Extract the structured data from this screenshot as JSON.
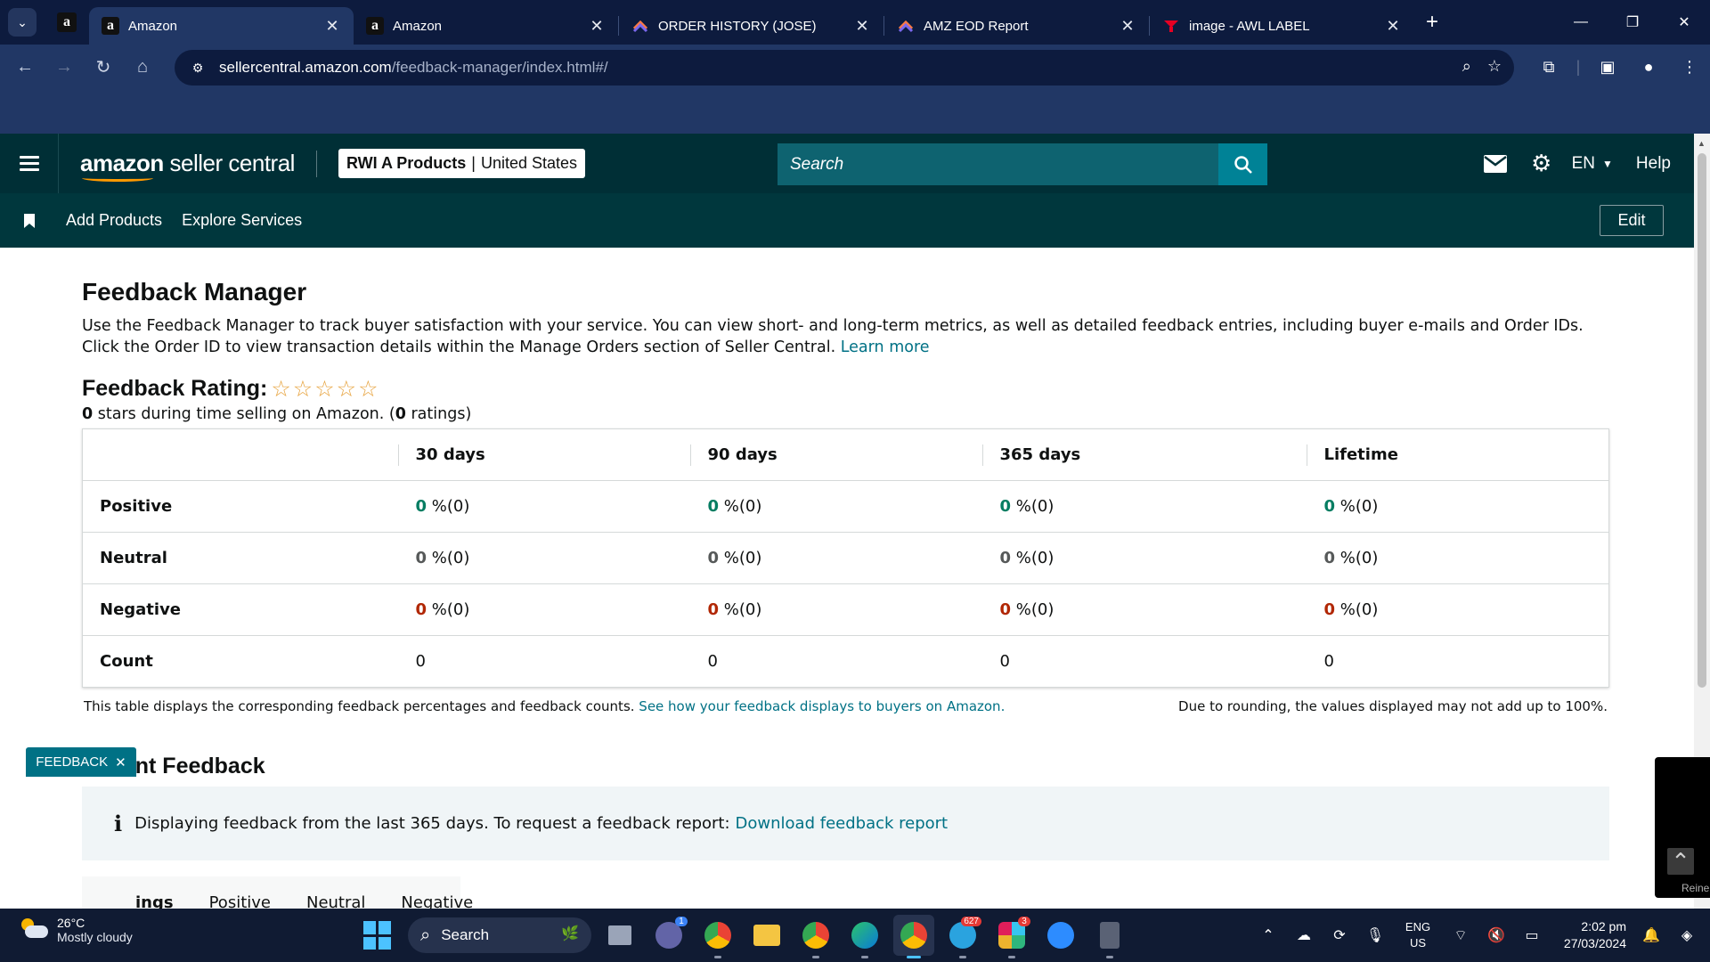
{
  "browser": {
    "tabs": [
      {
        "title": "Amazon",
        "icon": "amazon-icon",
        "active": true
      },
      {
        "title": "Amazon",
        "icon": "amazon-icon",
        "active": false
      },
      {
        "title": "ORDER HISTORY (JOSE)",
        "icon": "clickup-icon",
        "active": false
      },
      {
        "title": "AMZ EOD Report",
        "icon": "clickup-icon",
        "active": false
      },
      {
        "title": "image - AWL LABEL",
        "icon": "pinterest-icon",
        "active": false
      }
    ],
    "url_host": "sellercentral.amazon.com",
    "url_path": "/feedback-manager/index.html#/"
  },
  "header": {
    "logo_main": "amazon",
    "logo_sub": "seller central",
    "account_name": "RWI A Products",
    "account_sep": "|",
    "account_region": "United States",
    "search_placeholder": "Search",
    "language": "EN",
    "help": "Help"
  },
  "subnav": {
    "add_products": "Add Products",
    "explore_services": "Explore Services",
    "edit": "Edit"
  },
  "feedback": {
    "title": "Feedback Manager",
    "intro": "Use the Feedback Manager to track buyer satisfaction with your service. You can view short- and long-term metrics, as well as detailed feedback entries, including buyer e-mails and Order IDs. Click the Order ID to view transaction details within the Manage Orders section of Seller Central. ",
    "learn_more": "Learn more",
    "rating_label": "Feedback Rating:",
    "rating_stars": 0,
    "rating_summary_count": "0",
    "rating_summary_text": " stars during time selling on Amazon. (",
    "rating_summary_ratings": "0",
    "rating_summary_end": " ratings)"
  },
  "table": {
    "columns": [
      "30 days",
      "90 days",
      "365 days",
      "Lifetime"
    ],
    "rows": [
      {
        "label": "Positive",
        "values": [
          "0",
          "0",
          "0",
          "0"
        ],
        "suffix": " %(0)",
        "kind": "positive"
      },
      {
        "label": "Neutral",
        "values": [
          "0",
          "0",
          "0",
          "0"
        ],
        "suffix": " %(0)",
        "kind": "neutral"
      },
      {
        "label": "Negative",
        "values": [
          "0",
          "0",
          "0",
          "0"
        ],
        "suffix": " %(0)",
        "kind": "negative"
      },
      {
        "label": "Count",
        "values": [
          "0",
          "0",
          "0",
          "0"
        ],
        "suffix": "",
        "kind": "count"
      }
    ],
    "footnote_left": "This table displays the corresponding feedback percentages and feedback counts. ",
    "footnote_link": "See how your feedback displays to buyers on Amazon.",
    "footnote_right": "Due to rounding, the values displayed may not add up to 100%."
  },
  "recent": {
    "title": "Recent Feedback",
    "info": "Displaying feedback from the last 365 days. To request a feedback report: ",
    "info_link": "Download feedback report",
    "tabs": [
      "ings",
      "Positive",
      "Neutral",
      "Negative"
    ]
  },
  "overlay": {
    "feedback_tab": "FEEDBACK",
    "side_text": "Reine"
  },
  "taskbar": {
    "temp": "26°C",
    "weather": "Mostly cloudy",
    "search": "Search",
    "lang_1": "ENG",
    "lang_2": "US",
    "time": "2:02 pm",
    "date": "27/03/2024",
    "badges": {
      "teams": "1",
      "telegram": "627",
      "slack": "3"
    }
  },
  "colors": {
    "browser_dark": "#0d1b3e",
    "browser_toolbar": "#213765",
    "sc_header": "#002f36",
    "sc_subnav": "#00373d",
    "link": "#007185",
    "positive": "#067d62",
    "negative": "#b12704",
    "star": "#e7a33e"
  }
}
